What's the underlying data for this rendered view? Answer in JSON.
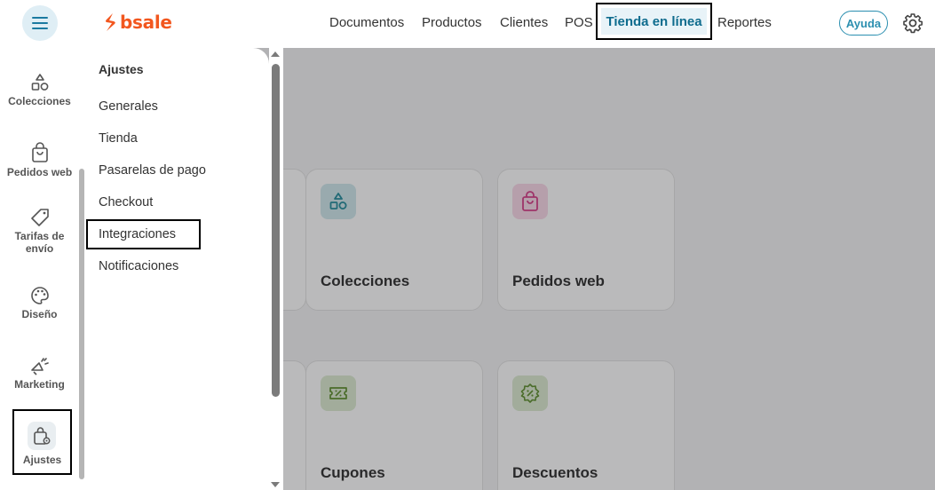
{
  "brand": {
    "name": "bsale",
    "color": "#f2571f"
  },
  "nav": {
    "items": [
      "Documentos",
      "Productos",
      "Clientes",
      "POS"
    ],
    "active": "Tienda en línea",
    "after": "Reportes",
    "help": "Ayuda"
  },
  "rail": {
    "items": [
      {
        "label": "Colecciones",
        "icon": "shapes-icon"
      },
      {
        "label": "Pedidos web",
        "icon": "shopping-bag-icon"
      },
      {
        "label": "Tarifas de envío",
        "icon": "tag-icon"
      },
      {
        "label": "Diseño",
        "icon": "palette-icon"
      },
      {
        "label": "Marketing",
        "icon": "megaphone-icon"
      },
      {
        "label": "Ajustes",
        "icon": "bag-settings-icon",
        "active": true
      }
    ]
  },
  "panel": {
    "title": "Ajustes",
    "items": [
      "Generales",
      "Tienda",
      "Pasarelas de pago",
      "Checkout",
      "Integraciones",
      "Notificaciones"
    ],
    "highlighted": "Integraciones"
  },
  "cards": [
    {
      "title": "Colecciones",
      "icon": "shapes-icon",
      "color": "#1e8a9a"
    },
    {
      "title": "Pedidos web",
      "icon": "shopping-bag-icon",
      "color": "#d63a86"
    },
    {
      "title": "Cupones",
      "icon": "coupon-icon",
      "color": "#5b8c2a"
    },
    {
      "title": "Descuentos",
      "icon": "discount-badge-icon",
      "color": "#5b8c2a"
    }
  ]
}
